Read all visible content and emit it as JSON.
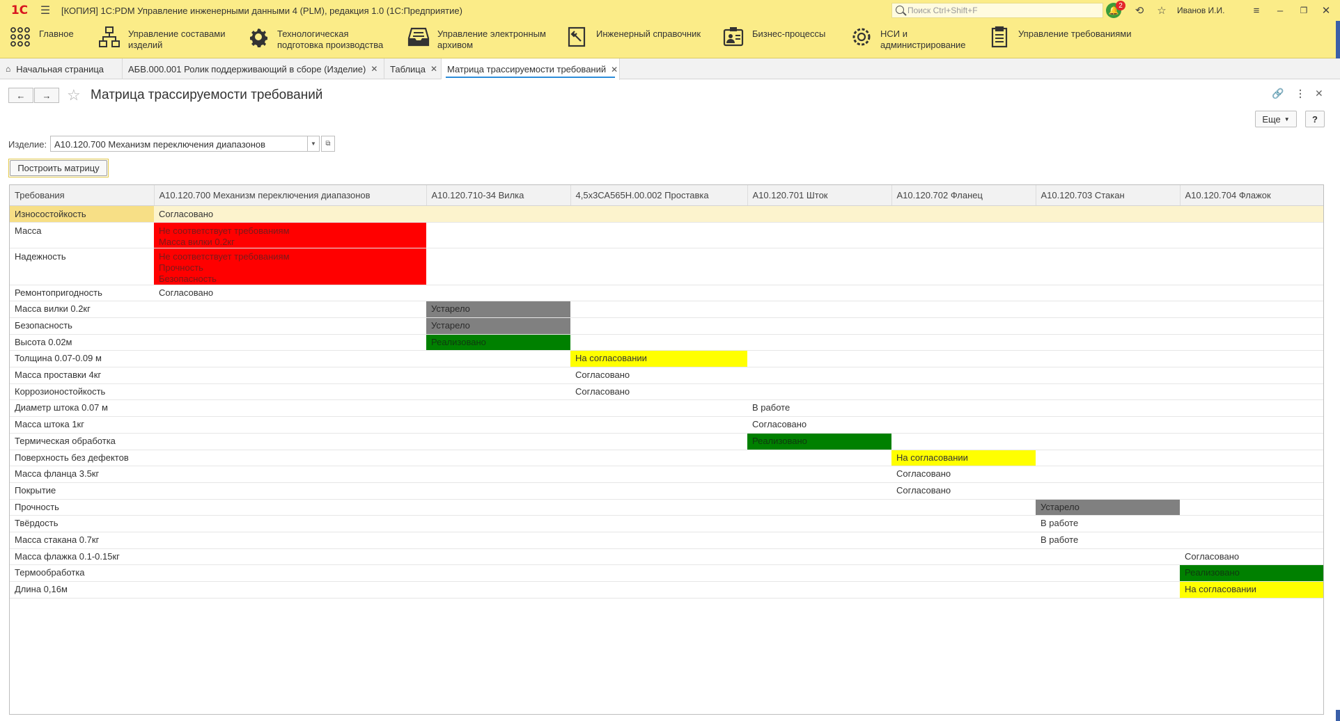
{
  "titlebar": {
    "logo": "1С",
    "title": "[КОПИЯ] 1С:PDM Управление инженерными данными 4 (PLM), редакция 1.0  (1С:Предприятие)",
    "search_placeholder": "Поиск Ctrl+Shift+F",
    "notifications_count": "2",
    "user": "Иванов И.И."
  },
  "sections": [
    {
      "label": "Главное",
      "icon": "grid-icon"
    },
    {
      "label": "Управление составами изделий",
      "icon": "structure-icon"
    },
    {
      "label": "Технологическая подготовка производства",
      "icon": "gear-icon"
    },
    {
      "label": "Управление электронным архивом",
      "icon": "archive-icon"
    },
    {
      "label": "Инженерный справочник",
      "icon": "handbook-icon"
    },
    {
      "label": "Бизнес-процессы",
      "icon": "process-icon"
    },
    {
      "label": "НСИ и администрирование",
      "icon": "settings-icon"
    },
    {
      "label": "Управление требованиями",
      "icon": "clipboard-icon"
    }
  ],
  "tabs": [
    {
      "label": "Начальная страница"
    },
    {
      "label": "АБВ.000.001 Ролик поддерживающий в сборе (Изделие)"
    },
    {
      "label": "Таблица"
    },
    {
      "label": "Матрица трассируемости требований"
    }
  ],
  "form": {
    "title": "Матрица трассируемости требований",
    "more_label": "Еще",
    "help_label": "?",
    "field_label": "Изделие:",
    "field_value": "А10.120.700 Механизм переключения диапазонов",
    "build_label": "Построить матрицу"
  },
  "colors": {
    "red": "#ff0000",
    "gray": "#808080",
    "green": "#008000",
    "yellow": "#ffff00",
    "selected_row": "#fcf3cd",
    "accent": "#fbec88"
  },
  "matrix": {
    "headers": [
      "Требования",
      "А10.120.700 Механизм переключения диапазонов",
      "А10.120.710-34 Вилка",
      "4,5х3СА565Н.00.002 Проставка",
      "А10.120.701 Шток",
      "А10.120.702 Фланец",
      "А10.120.703 Стакан",
      "А10.120.704 Флажок"
    ],
    "rows": [
      {
        "req": "Износостойкость",
        "col": 1,
        "status": "Согласовано",
        "color": "none"
      },
      {
        "req": "Масса",
        "col": 1,
        "status": "Не соответствует требованиям\nМасса вилки 0.2кг",
        "color": "red"
      },
      {
        "req": "Надежность",
        "col": 1,
        "status": "Не соответствует требованиям\nПрочность\nБезопасность",
        "color": "red"
      },
      {
        "req": "Ремонтопригодность",
        "col": 1,
        "status": "Согласовано",
        "color": "none"
      },
      {
        "req": "Масса вилки 0.2кг",
        "col": 2,
        "status": "Устарело",
        "color": "gray"
      },
      {
        "req": "Безопасность",
        "col": 2,
        "status": "Устарело",
        "color": "gray"
      },
      {
        "req": "Высота 0.02м",
        "col": 2,
        "status": "Реализовано",
        "color": "green"
      },
      {
        "req": "Толщина 0.07-0.09 м",
        "col": 3,
        "status": "На согласовании",
        "color": "yellow"
      },
      {
        "req": "Масса проставки 4кг",
        "col": 3,
        "status": "Согласовано",
        "color": "none"
      },
      {
        "req": "Коррозионостойкость",
        "col": 3,
        "status": "Согласовано",
        "color": "none"
      },
      {
        "req": "Диаметр штока 0.07 м",
        "col": 4,
        "status": "В работе",
        "color": "none"
      },
      {
        "req": "Масса штока 1кг",
        "col": 4,
        "status": "Согласовано",
        "color": "none"
      },
      {
        "req": "Термическая обработка",
        "col": 4,
        "status": "Реализовано",
        "color": "green"
      },
      {
        "req": "Поверхность без дефектов",
        "col": 5,
        "status": "На согласовании",
        "color": "yellow"
      },
      {
        "req": "Масса фланца 3.5кг",
        "col": 5,
        "status": "Согласовано",
        "color": "none"
      },
      {
        "req": "Покрытие",
        "col": 5,
        "status": "Согласовано",
        "color": "none"
      },
      {
        "req": "Прочность",
        "col": 6,
        "status": "Устарело",
        "color": "gray"
      },
      {
        "req": "Твёрдость",
        "col": 6,
        "status": "В работе",
        "color": "none"
      },
      {
        "req": "Масса стакана 0.7кг",
        "col": 6,
        "status": "В работе",
        "color": "none"
      },
      {
        "req": "Масса флажка 0.1-0.15кг",
        "col": 7,
        "status": "Согласовано",
        "color": "none"
      },
      {
        "req": "Термообработка",
        "col": 7,
        "status": "Реализовано",
        "color": "green"
      },
      {
        "req": "Длина 0,16м",
        "col": 7,
        "status": "На согласовании",
        "color": "yellow"
      }
    ]
  }
}
